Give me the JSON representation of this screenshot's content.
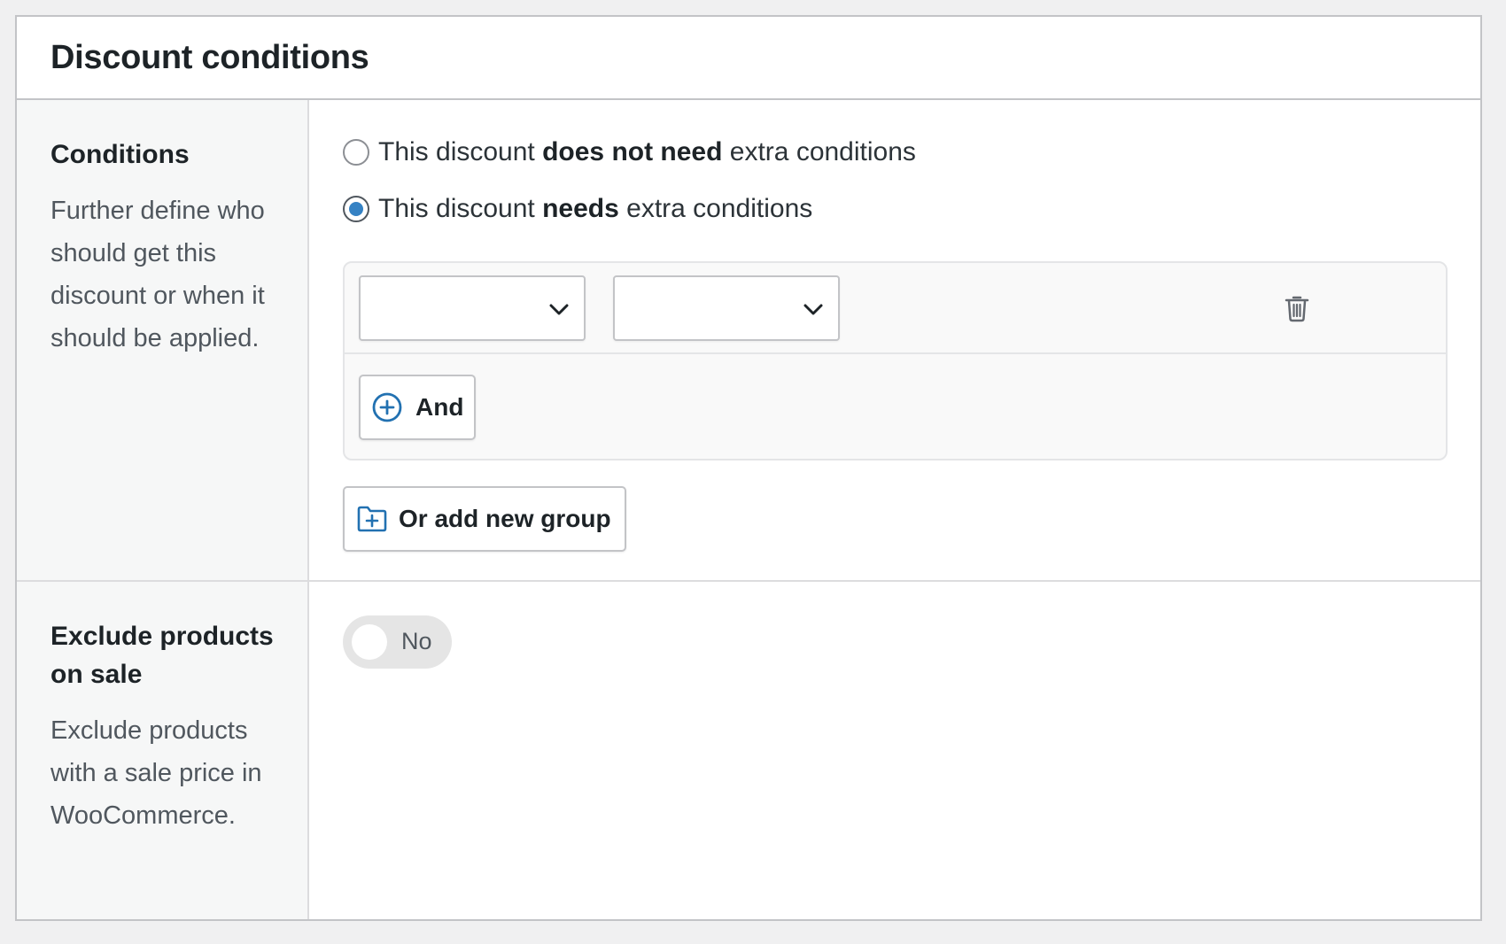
{
  "panel": {
    "title": "Discount conditions"
  },
  "conditions": {
    "title": "Conditions",
    "description": "Further define who should get this discount or when it should be applied.",
    "options": [
      {
        "prefix": "This discount ",
        "emphasis": "does not need",
        "suffix": " extra conditions",
        "checked": false
      },
      {
        "prefix": "This discount ",
        "emphasis": "needs",
        "suffix": " extra conditions",
        "checked": true
      }
    ],
    "group": {
      "select_1": {
        "value": "",
        "icon": "chevron-down-icon"
      },
      "select_2": {
        "value": "",
        "icon": "chevron-down-icon"
      },
      "delete_icon": "trash-icon",
      "and_label": "And",
      "and_icon": "plus-circle-icon"
    },
    "add_group_label": "Or add new group",
    "add_group_icon": "folder-plus-icon"
  },
  "exclude_sale": {
    "title": "Exclude products on sale",
    "description": "Exclude products with a sale price in WooCommerce.",
    "toggle_label": "No",
    "toggle_on": false
  },
  "colors": {
    "accent": "#3582c4",
    "icon_blue": "#2271b1",
    "border": "#c3c4c7",
    "sidebar_bg": "#f6f7f7",
    "page_bg": "#f0f0f1"
  }
}
